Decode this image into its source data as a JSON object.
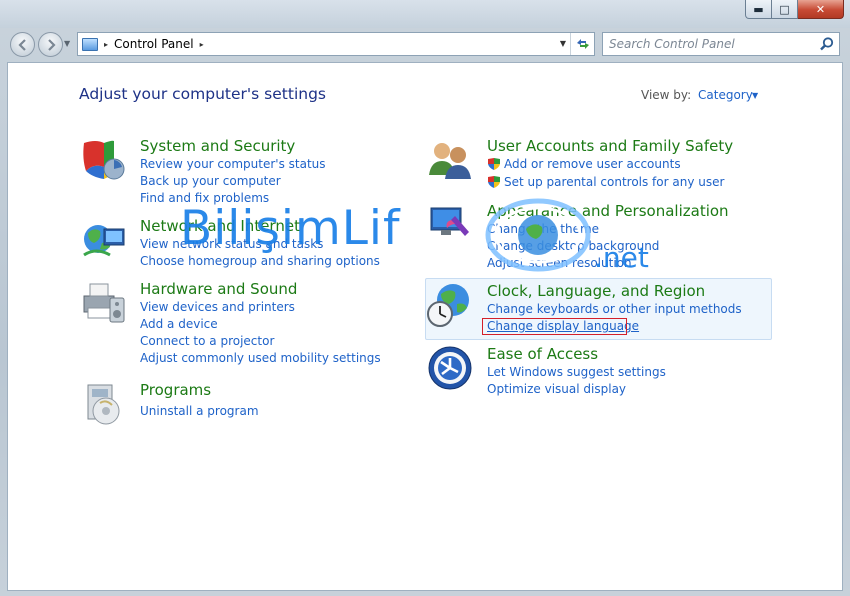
{
  "window": {
    "min_label": "▬",
    "max_label": "□",
    "close_label": "✕"
  },
  "address": {
    "location": "Control Panel",
    "separator": "▸"
  },
  "search": {
    "placeholder": "Search Control Panel"
  },
  "page": {
    "heading": "Adjust your computer's settings",
    "view_by_label": "View by:",
    "view_by_value": "Category"
  },
  "categories": {
    "system_security": {
      "title": "System and Security",
      "links": [
        "Review your computer's status",
        "Back up your computer",
        "Find and fix problems"
      ]
    },
    "network": {
      "title": "Network and Internet",
      "links": [
        "View network status and tasks",
        "Choose homegroup and sharing options"
      ]
    },
    "hardware": {
      "title": "Hardware and Sound",
      "links": [
        "View devices and printers",
        "Add a device",
        "Connect to a projector",
        "Adjust commonly used mobility settings"
      ]
    },
    "programs": {
      "title": "Programs",
      "links": [
        "Uninstall a program"
      ]
    },
    "user_accounts": {
      "title": "User Accounts and Family Safety",
      "links": [
        "Add or remove user accounts",
        "Set up parental controls for any user"
      ]
    },
    "appearance": {
      "title": "Appearance and Personalization",
      "links": [
        "Change the theme",
        "Change desktop background",
        "Adjust screen resolution"
      ]
    },
    "clock": {
      "title": "Clock, Language, and Region",
      "links": [
        "Change keyboards or other input methods",
        "Change display language"
      ]
    },
    "ease": {
      "title": "Ease of Access",
      "links": [
        "Let Windows suggest settings",
        "Optimize visual display"
      ]
    }
  },
  "watermark": {
    "text_main": "BilişimLif",
    "text_suffix": ".net"
  },
  "colors": {
    "link": "#1e62c8",
    "title": "#1c7a15",
    "heading": "#1e3287",
    "highlight_box": "#d4202a"
  }
}
